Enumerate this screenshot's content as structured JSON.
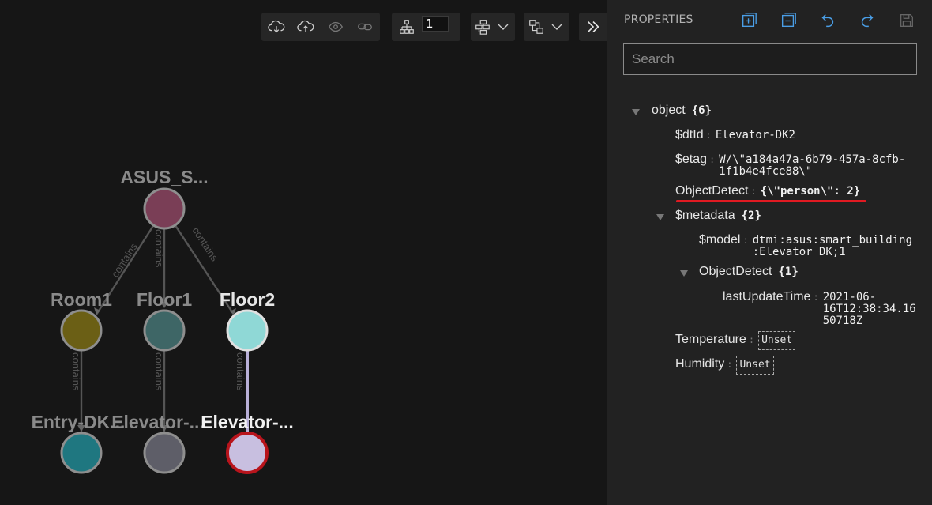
{
  "toolbar": {
    "depth_value": "1"
  },
  "graph": {
    "nodes": {
      "root": "ASUS_S...",
      "room1": "Room1",
      "floor1": "Floor1",
      "floor2": "Floor2",
      "entry": "Entry-DK...",
      "elevator1": "Elevator-...",
      "elevator2": "Elevator-..."
    },
    "edge_label": "contains",
    "colors": {
      "root": "#7a3e56",
      "room1": "#6b5f15",
      "floor1": "#3e6666",
      "floor2": "#8fd8d6",
      "entry": "#1f7780",
      "elevator1": "#5e5e68",
      "elevator2": "#c8bfe0",
      "selected_border": "#b8141c"
    }
  },
  "properties": {
    "title": "PROPERTIES",
    "search_placeholder": "Search",
    "object_label": "object",
    "object_count": "{6}",
    "dtid_key": "$dtId",
    "dtid_value": "Elevator-DK2",
    "etag_key": "$etag",
    "etag_value": "W/\\\"a184a47a-6b79-457a-8cfb-\n1f1b4e4fce88\\\"",
    "objectdetect_key": "ObjectDetect",
    "objectdetect_value": "{\\\"person\\\": 2}",
    "metadata_key": "$metadata",
    "metadata_count": "{2}",
    "model_key": "$model",
    "model_value": "dtmi:asus:smart_building\n:Elevator_DK;1",
    "meta_objectdetect_key": "ObjectDetect",
    "meta_objectdetect_count": "{1}",
    "lastupdate_key": "lastUpdateTime",
    "lastupdate_value": "2021-06-\n16T12:38:34.16\n50718Z",
    "temperature_key": "Temperature",
    "temperature_value": "Unset",
    "humidity_key": "Humidity",
    "humidity_value": "Unset"
  },
  "accent": "#4a9ee6",
  "highlight": "#e01a22"
}
